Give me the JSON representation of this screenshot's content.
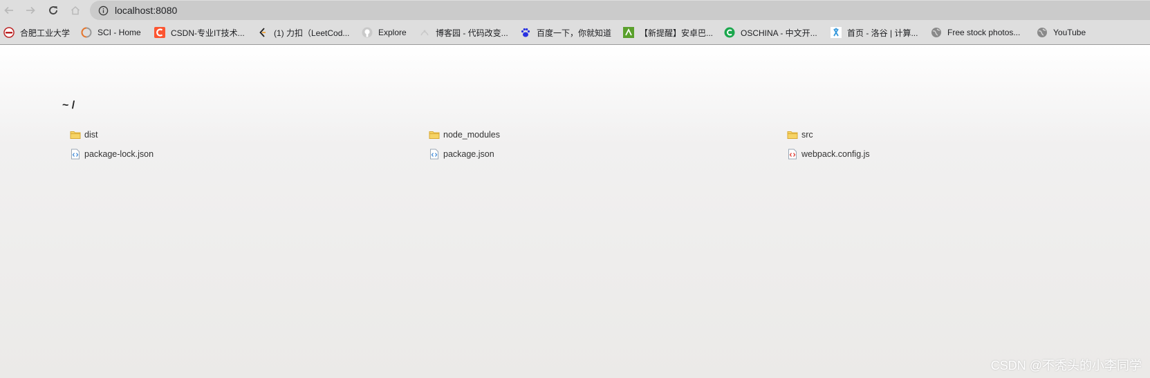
{
  "browser": {
    "url": "localhost:8080",
    "bookmarks": [
      {
        "label": "合肥工业大学",
        "icon": "university-seal-icon"
      },
      {
        "label": "SCI - Home",
        "icon": "sci-icon"
      },
      {
        "label": "CSDN-专业IT技术...",
        "icon": "csdn-icon",
        "color": "#fc5531"
      },
      {
        "label": "(1) 力扣（LeetCod...",
        "icon": "leetcode-icon"
      },
      {
        "label": "Explore",
        "icon": "github-icon"
      },
      {
        "label": "博客园 - 代码改变...",
        "icon": "cnblogs-icon"
      },
      {
        "label": "百度一下，你就知道",
        "icon": "baidu-paw-icon",
        "color": "#2932e1"
      },
      {
        "label": "【新提醒】安卓巴...",
        "icon": "android-bar-icon",
        "color": "#5aa02c"
      },
      {
        "label": "OSCHINA - 中文开...",
        "icon": "oschina-icon",
        "color": "#1ba74d"
      },
      {
        "label": "首页 - 洛谷 | 计算...",
        "icon": "luogu-icon",
        "color": "#3498db"
      },
      {
        "label": "Free stock photos...",
        "icon": "globe-icon"
      },
      {
        "label": "YouTube",
        "icon": "globe-icon"
      }
    ]
  },
  "listing": {
    "breadcrumb": "~ /",
    "entries": [
      {
        "name": "dist",
        "type": "folder"
      },
      {
        "name": "node_modules",
        "type": "folder"
      },
      {
        "name": "src",
        "type": "folder"
      },
      {
        "name": "package-lock.json",
        "type": "json-file",
        "color": "#4a90d9"
      },
      {
        "name": "package.json",
        "type": "json-file",
        "color": "#4a90d9"
      },
      {
        "name": "webpack.config.js",
        "type": "js-file",
        "color": "#e0433a"
      }
    ]
  },
  "watermark": "CSDN @不秃头的小李同学"
}
